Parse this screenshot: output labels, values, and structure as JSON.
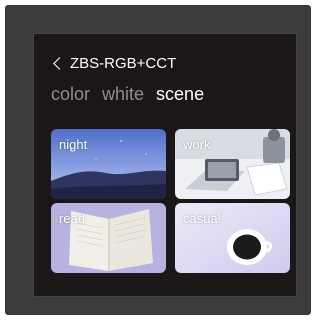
{
  "header": {
    "back_icon": "chevron-left-icon",
    "device_name": "ZBS-RGB+CCT"
  },
  "tabs": [
    {
      "label": "color",
      "active": false
    },
    {
      "label": "white",
      "active": false
    },
    {
      "label": "scene",
      "active": true
    }
  ],
  "scenes": [
    {
      "label": "night"
    },
    {
      "label": "work"
    },
    {
      "label": "read"
    },
    {
      "label": "casual"
    }
  ],
  "colors": {
    "frame": "#3b3b3b",
    "panel": "#1b1718",
    "tab_active": "#ffffff",
    "tab_inactive": "#8d8d93"
  }
}
